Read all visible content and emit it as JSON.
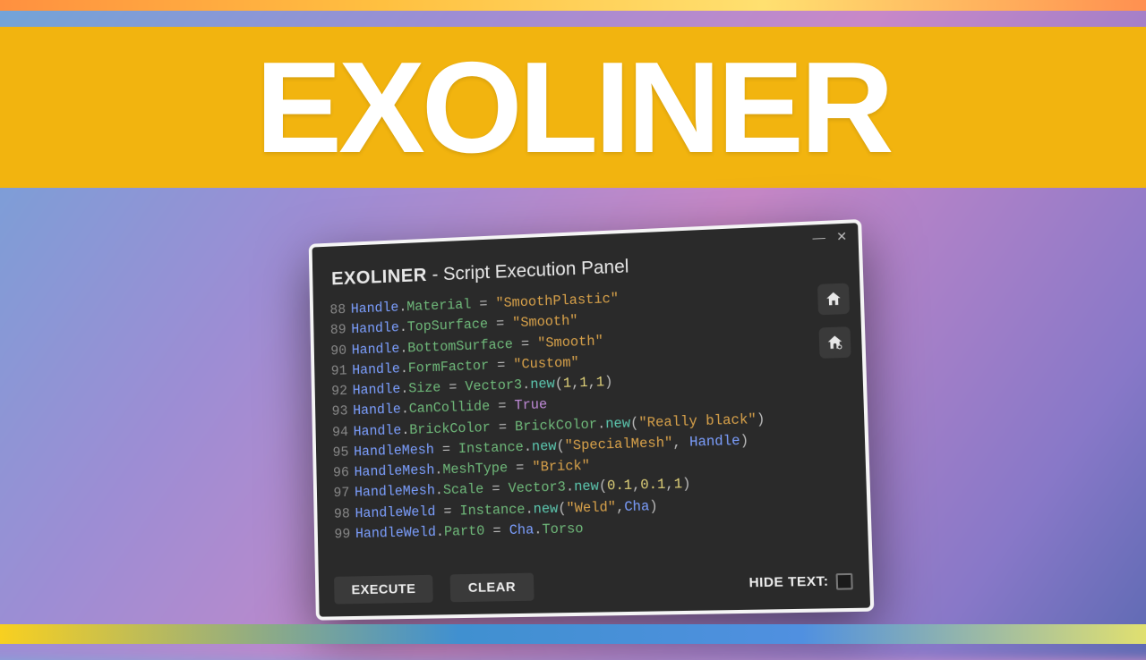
{
  "banner": {
    "title": "EXOLINER"
  },
  "panel": {
    "name": "EXOLINER",
    "subtitle": "- Script Execution Panel",
    "window": {
      "minimize": "—",
      "close": "✕"
    },
    "code": [
      {
        "n": "88",
        "tokens": [
          [
            "obj",
            "Handle"
          ],
          [
            ".",
            "."
          ],
          [
            "prop",
            "Material"
          ],
          [
            " = ",
            " = "
          ],
          [
            "str",
            "\"SmoothPlastic\""
          ]
        ]
      },
      {
        "n": "89",
        "tokens": [
          [
            "obj",
            "Handle"
          ],
          [
            ".",
            "."
          ],
          [
            "prop",
            "TopSurface"
          ],
          [
            " = ",
            " = "
          ],
          [
            "str",
            "\"Smooth\""
          ]
        ]
      },
      {
        "n": "90",
        "tokens": [
          [
            "obj",
            "Handle"
          ],
          [
            ".",
            "."
          ],
          [
            "prop",
            "BottomSurface"
          ],
          [
            " = ",
            " = "
          ],
          [
            "str",
            "\"Smooth\""
          ]
        ]
      },
      {
        "n": "91",
        "tokens": [
          [
            "obj",
            "Handle"
          ],
          [
            ".",
            "."
          ],
          [
            "prop",
            "FormFactor"
          ],
          [
            " = ",
            " = "
          ],
          [
            "str",
            "\"Custom\""
          ]
        ]
      },
      {
        "n": "92",
        "tokens": [
          [
            "obj",
            "Handle"
          ],
          [
            ".",
            "."
          ],
          [
            "prop",
            "Size"
          ],
          [
            " = ",
            " = "
          ],
          [
            "type",
            "Vector3"
          ],
          [
            ".",
            "."
          ],
          [
            "func",
            "new"
          ],
          [
            "",
            "("
          ],
          [
            "num",
            "1"
          ],
          [
            "",
            ","
          ],
          [
            "num",
            "1"
          ],
          [
            "",
            ","
          ],
          [
            "num",
            "1"
          ],
          [
            "",
            ")"
          ]
        ]
      },
      {
        "n": "93",
        "tokens": [
          [
            "obj",
            "Handle"
          ],
          [
            ".",
            "."
          ],
          [
            "prop",
            "CanCollide"
          ],
          [
            " = ",
            " = "
          ],
          [
            "kw",
            "True"
          ]
        ]
      },
      {
        "n": "94",
        "tokens": [
          [
            "obj",
            "Handle"
          ],
          [
            ".",
            "."
          ],
          [
            "prop",
            "BrickColor"
          ],
          [
            " = ",
            " = "
          ],
          [
            "type",
            "BrickColor"
          ],
          [
            ".",
            "."
          ],
          [
            "func",
            "new"
          ],
          [
            "",
            "("
          ],
          [
            "str",
            "\"Really black\""
          ],
          [
            "",
            ")"
          ]
        ]
      },
      {
        "n": "95",
        "tokens": [
          [
            "obj",
            "HandleMesh"
          ],
          [
            " = ",
            " = "
          ],
          [
            "type",
            "Instance"
          ],
          [
            ".",
            "."
          ],
          [
            "func",
            "new"
          ],
          [
            "",
            "("
          ],
          [
            "str",
            "\"SpecialMesh\""
          ],
          [
            "",
            ", "
          ],
          [
            "obj",
            "Handle"
          ],
          [
            "",
            ")"
          ]
        ]
      },
      {
        "n": "96",
        "tokens": [
          [
            "obj",
            "HandleMesh"
          ],
          [
            ".",
            "."
          ],
          [
            "prop",
            "MeshType"
          ],
          [
            " = ",
            " = "
          ],
          [
            "str",
            "\"Brick\""
          ]
        ]
      },
      {
        "n": "97",
        "tokens": [
          [
            "obj",
            "HandleMesh"
          ],
          [
            ".",
            "."
          ],
          [
            "prop",
            "Scale"
          ],
          [
            " = ",
            " = "
          ],
          [
            "type",
            "Vector3"
          ],
          [
            ".",
            "."
          ],
          [
            "func",
            "new"
          ],
          [
            "",
            "("
          ],
          [
            "num",
            "0.1"
          ],
          [
            "",
            ","
          ],
          [
            "num",
            "0.1"
          ],
          [
            "",
            ","
          ],
          [
            "num",
            "1"
          ],
          [
            "",
            ")"
          ]
        ]
      },
      {
        "n": "98",
        "tokens": [
          [
            "obj",
            "HandleWeld"
          ],
          [
            " = ",
            " = "
          ],
          [
            "type",
            "Instance"
          ],
          [
            ".",
            "."
          ],
          [
            "func",
            "new"
          ],
          [
            "",
            "("
          ],
          [
            "str",
            "\"Weld\""
          ],
          [
            "",
            ","
          ],
          [
            "obj",
            "Cha"
          ],
          [
            "",
            ")"
          ]
        ]
      },
      {
        "n": "99",
        "tokens": [
          [
            "obj",
            "HandleWeld"
          ],
          [
            ".",
            "."
          ],
          [
            "prop",
            "Part0"
          ],
          [
            " = ",
            " = "
          ],
          [
            "obj",
            "Cha"
          ],
          [
            ".",
            "."
          ],
          [
            "prop",
            "Torso"
          ]
        ]
      }
    ],
    "buttons": {
      "execute": "EXECUTE",
      "clear": "CLEAR",
      "hide": "HIDE TEXT:"
    },
    "icons": {
      "home": "home-icon",
      "settings": "home-gear-icon"
    }
  }
}
